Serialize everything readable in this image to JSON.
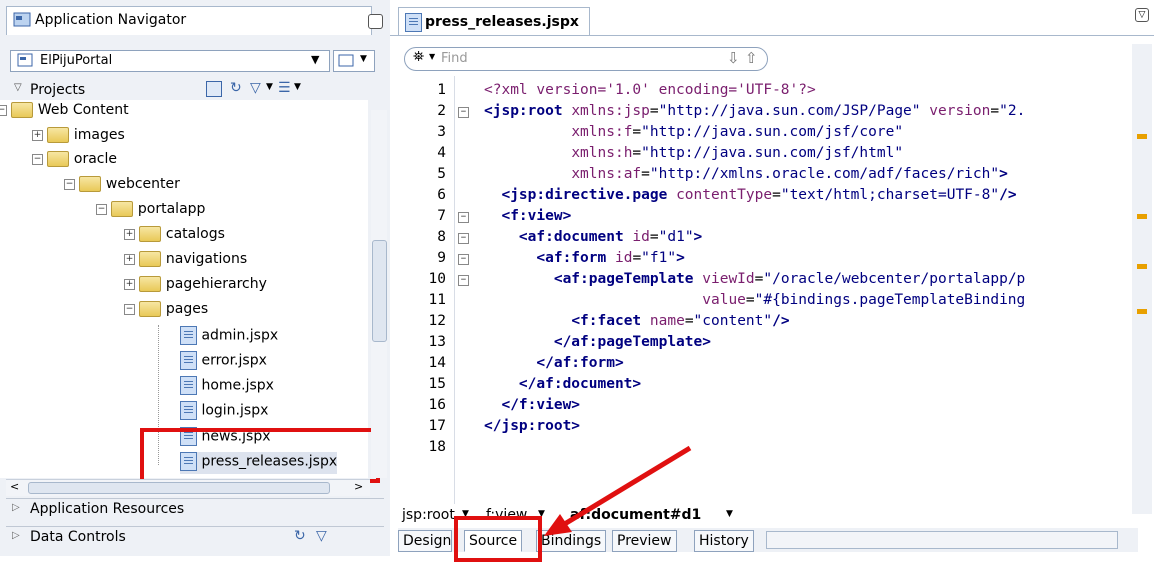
{
  "navigator": {
    "title": "Application Navigator",
    "app_name": "ElPijuPortal",
    "projects_label": "Projects",
    "tree": [
      {
        "label": "Web Content",
        "level": 1,
        "type": "folder"
      },
      {
        "label": "images",
        "level": 2,
        "type": "folder"
      },
      {
        "label": "oracle",
        "level": 2,
        "type": "folder"
      },
      {
        "label": "webcenter",
        "level": 3,
        "type": "folder"
      },
      {
        "label": "portalapp",
        "level": 4,
        "type": "folder"
      },
      {
        "label": "catalogs",
        "level": 5,
        "type": "folder"
      },
      {
        "label": "navigations",
        "level": 5,
        "type": "folder"
      },
      {
        "label": "pagehierarchy",
        "level": 5,
        "type": "folder"
      },
      {
        "label": "pages",
        "level": 5,
        "type": "folder"
      },
      {
        "label": "admin.jspx",
        "level": 6,
        "type": "file"
      },
      {
        "label": "error.jspx",
        "level": 6,
        "type": "file"
      },
      {
        "label": "home.jspx",
        "level": 6,
        "type": "file"
      },
      {
        "label": "login.jspx",
        "level": 6,
        "type": "file"
      },
      {
        "label": "news.jspx",
        "level": 6,
        "type": "file"
      },
      {
        "label": "press_releases.jspx",
        "level": 6,
        "type": "file"
      }
    ],
    "accordion": [
      "Application Resources",
      "Data Controls"
    ]
  },
  "editor": {
    "tab_title": "press_releases.jspx",
    "find_placeholder": "Find",
    "lines": [
      "1",
      "2",
      "3",
      "4",
      "5",
      "6",
      "7",
      "8",
      "9",
      "10",
      "11",
      "12",
      "13",
      "14",
      "15",
      "16",
      "17",
      "18"
    ],
    "breadcrumb": [
      "jsp:root",
      "f:view",
      "af:document#d1"
    ],
    "bottom_tabs": [
      "Design",
      "Source",
      "Bindings",
      "Preview",
      "History"
    ],
    "active_tab": "Source"
  },
  "colors": {
    "highlight": "#e01010",
    "tag": "#000080",
    "attr": "#7a1e6e"
  }
}
